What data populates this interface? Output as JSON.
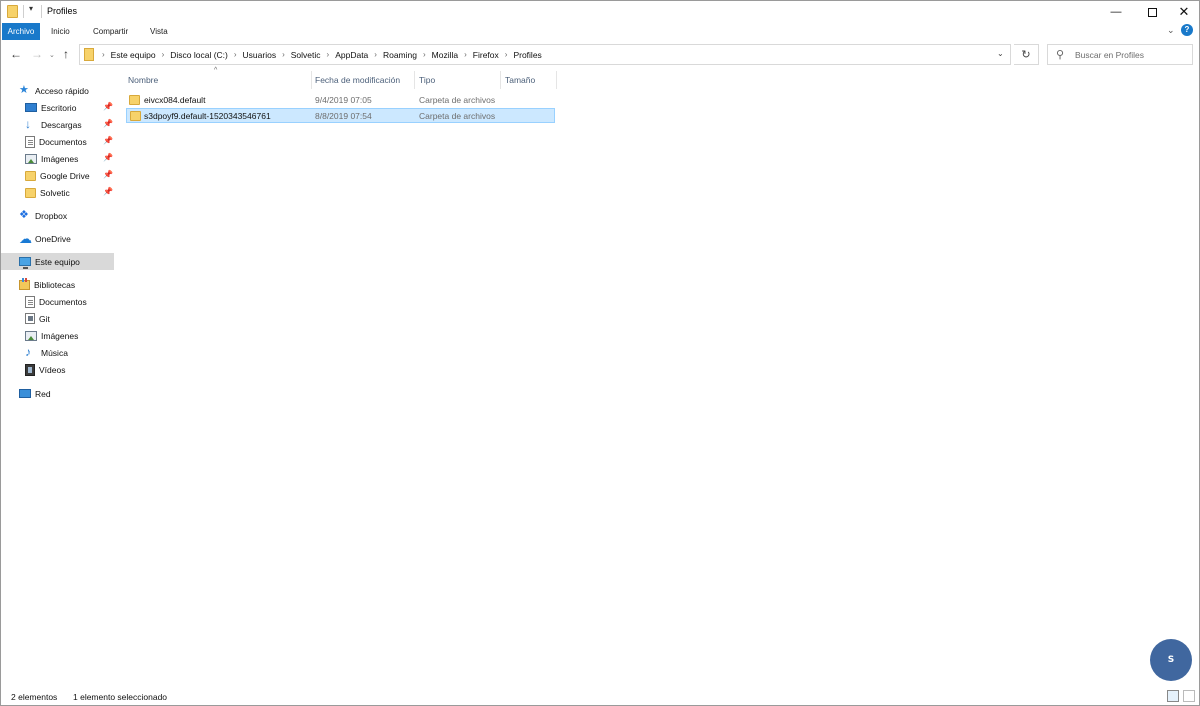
{
  "window": {
    "title": "Profiles",
    "controls": {
      "minimize": "—",
      "maximize": "",
      "close": "✕"
    }
  },
  "ribbon": {
    "tabs": [
      {
        "label": "Archivo",
        "active": true
      },
      {
        "label": "Inicio"
      },
      {
        "label": "Compartir"
      },
      {
        "label": "Vista"
      }
    ],
    "help_label": "?"
  },
  "nav": {
    "back_icon": "arrow-left",
    "forward_icon": "arrow-right",
    "recent_icon": "chevron-down",
    "up_icon": "arrow-up"
  },
  "address": {
    "path": [
      "Este equipo",
      "Disco local (C:)",
      "Usuarios",
      "Solvetic",
      "AppData",
      "Roaming",
      "Mozilla",
      "Firefox",
      "Profiles"
    ],
    "refresh_icon": "refresh"
  },
  "search": {
    "placeholder": "Buscar en Profiles"
  },
  "sidebar": {
    "quick_access": {
      "label": "Acceso rápido",
      "items": [
        {
          "label": "Escritorio",
          "icon": "desktop-icon",
          "pinned": true
        },
        {
          "label": "Descargas",
          "icon": "download-icon",
          "pinned": true
        },
        {
          "label": "Documentos",
          "icon": "document-icon",
          "pinned": true
        },
        {
          "label": "Imágenes",
          "icon": "pictures-icon",
          "pinned": true
        },
        {
          "label": "Google Drive",
          "icon": "folder-icon",
          "pinned": true
        },
        {
          "label": "Solvetic",
          "icon": "folder-icon",
          "pinned": true
        }
      ]
    },
    "dropbox": {
      "label": "Dropbox"
    },
    "onedrive": {
      "label": "OneDrive"
    },
    "this_pc": {
      "label": "Este equipo",
      "selected": true
    },
    "libraries": {
      "label": "Bibliotecas",
      "items": [
        {
          "label": "Documentos",
          "icon": "document-icon"
        },
        {
          "label": "Git",
          "icon": "git-icon"
        },
        {
          "label": "Imágenes",
          "icon": "pictures-icon"
        },
        {
          "label": "Música",
          "icon": "music-icon"
        },
        {
          "label": "Vídeos",
          "icon": "video-icon"
        }
      ]
    },
    "network": {
      "label": "Red"
    }
  },
  "columns": {
    "name": "Nombre",
    "date": "Fecha de modificación",
    "type": "Tipo",
    "size": "Tamaño"
  },
  "files": [
    {
      "name": "eivcx084.default",
      "date": "9/4/2019 07:05",
      "type": "Carpeta de archivos",
      "size": "",
      "selected": false
    },
    {
      "name": "s3dpoyf9.default-1520343546761",
      "date": "8/8/2019 07:54",
      "type": "Carpeta de archivos",
      "size": "",
      "selected": true
    }
  ],
  "status": {
    "count": "2 elementos",
    "selection": "1 elemento seleccionado"
  },
  "watermark": {
    "text": "S"
  },
  "colors": {
    "accent": "#1979ca",
    "selection_bg": "#cce8ff",
    "selection_border": "#99d1ff",
    "folder": "#f7d26a"
  }
}
